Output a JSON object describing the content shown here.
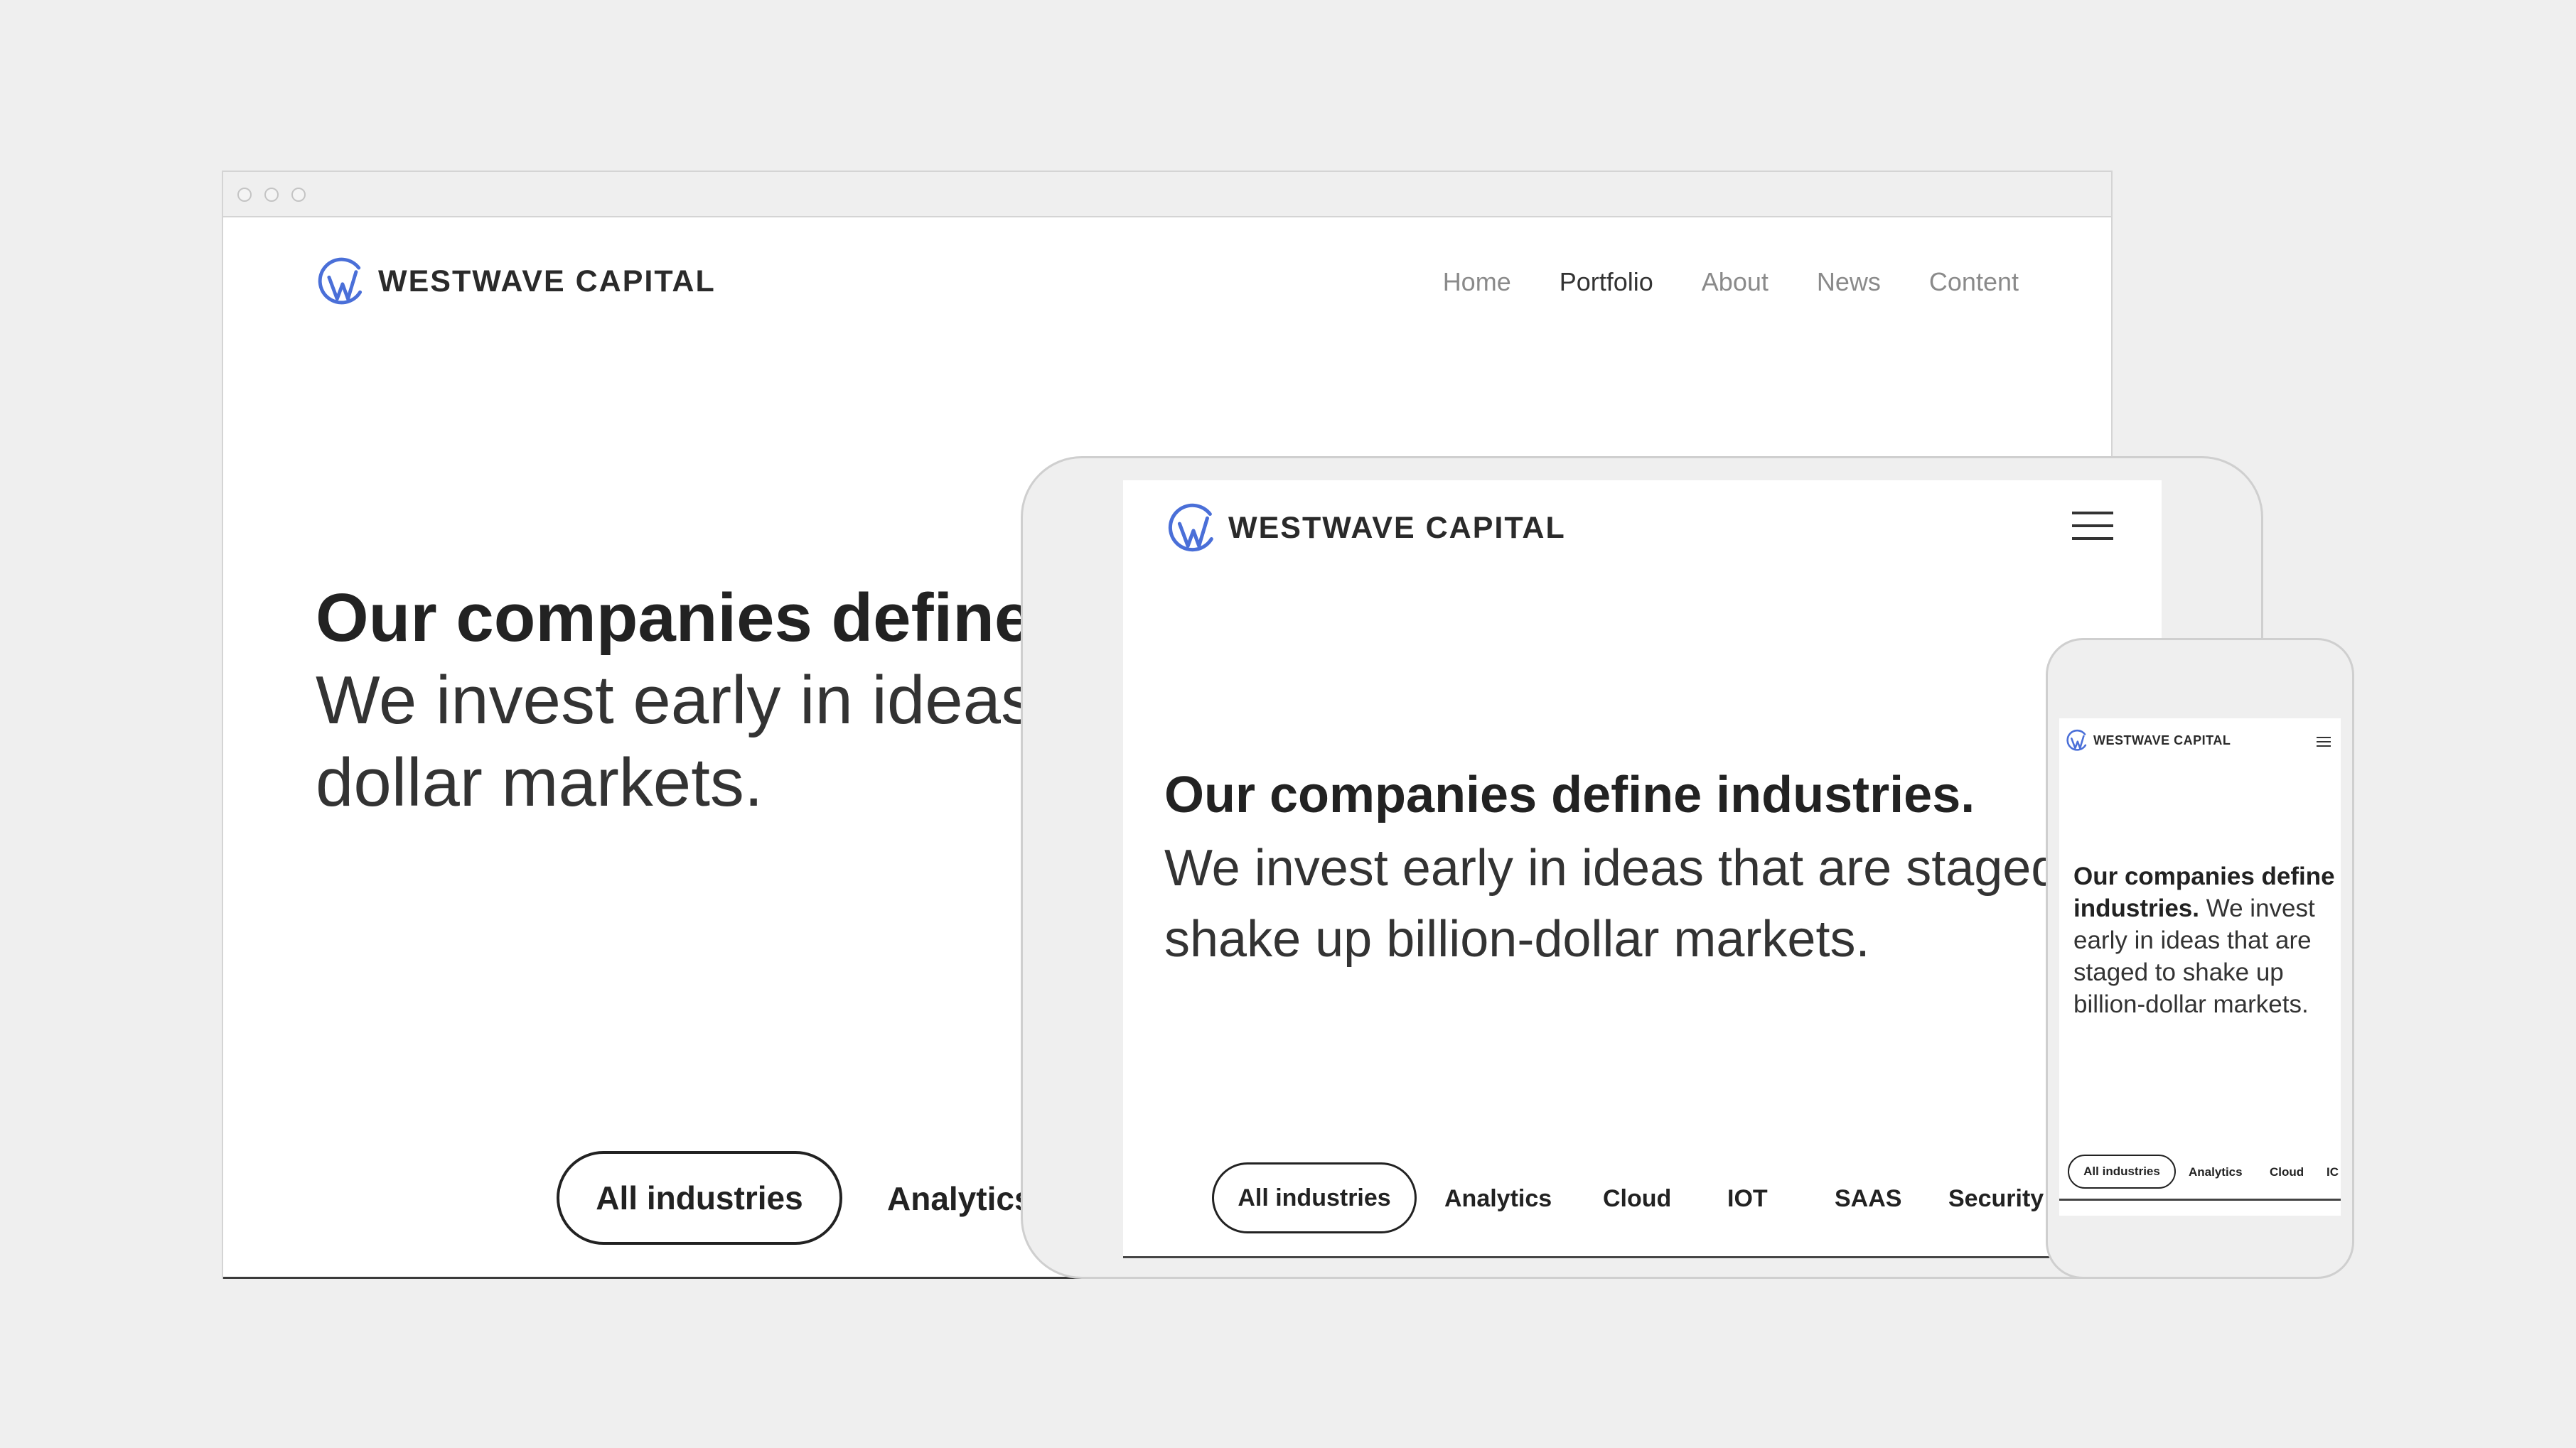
{
  "brand": {
    "name": "WESTWAVE CAPITAL",
    "accent": "#4a6fd8"
  },
  "desktop": {
    "nav": [
      "Home",
      "Portfolio",
      "About",
      "News",
      "Content"
    ],
    "active_nav": "Portfolio",
    "headline": "Our companies define",
    "lead": "We invest early in ideas billion-dollar markets.",
    "filters": [
      "All industries",
      "Analytics"
    ]
  },
  "tablet": {
    "menu_icon": "hamburger-icon",
    "headline": "Our companies define industries.",
    "lead": "We invest early in ideas that are staged shake up billion-dollar markets.",
    "filters": [
      "All industries",
      "Analytics",
      "Cloud",
      "IOT",
      "SAAS",
      "Security"
    ]
  },
  "phone": {
    "menu_icon": "hamburger-icon",
    "headline": "Our companies define industries.",
    "lead": "We invest early in ideas that are staged to shake up billion-dollar markets.",
    "filters": [
      "All industries",
      "Analytics",
      "Cloud",
      "IC"
    ]
  }
}
